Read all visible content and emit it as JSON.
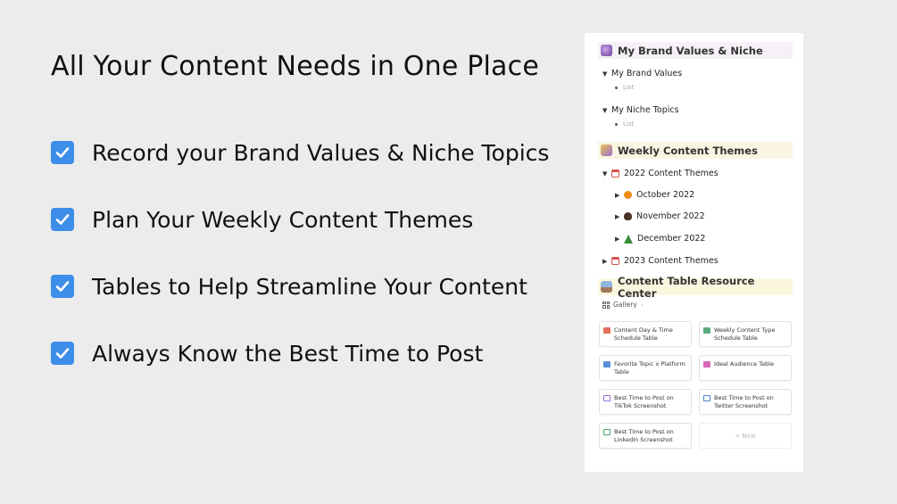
{
  "headline": "All Your Content Needs in One Place",
  "features": [
    "Record your Brand Values & Niche Topics",
    "Plan Your Weekly Content Themes",
    "Tables to Help Streamline Your Content",
    "Always Know the Best Time to Post"
  ],
  "panel": {
    "brand_section": {
      "title": "My Brand Values & Niche",
      "toggles": [
        {
          "label": "My Brand Values",
          "child": "List"
        },
        {
          "label": "My Niche Topics",
          "child": "List"
        }
      ]
    },
    "weekly_section": {
      "title": "Weekly Content Themes",
      "year_2022": "2022 Content Themes",
      "months": [
        "October 2022",
        "November 2022",
        "December 2022"
      ],
      "year_2023": "2023 Content Themes"
    },
    "resource_section": {
      "title": "Content Table Resource Center",
      "view_label": "Gallery",
      "cards": [
        "Content Day & Time Schedule Table",
        "Weekly Content Type Schedule Table",
        "Favorite Topic x Platform Table",
        "Ideal Audience Table",
        "Best Time to Post on TikTok Screenshot",
        "Best Time to Post on Twitter Screenshot",
        "Best Time to Post on LinkedIn Screenshot"
      ],
      "new_label": "+ New"
    }
  },
  "colors": {
    "checkbox": "#3d8ee8",
    "brand_header_bg": "#f6f1f6",
    "weekly_header_bg": "#faf4e3",
    "resource_header_bg": "#fbf6de"
  }
}
